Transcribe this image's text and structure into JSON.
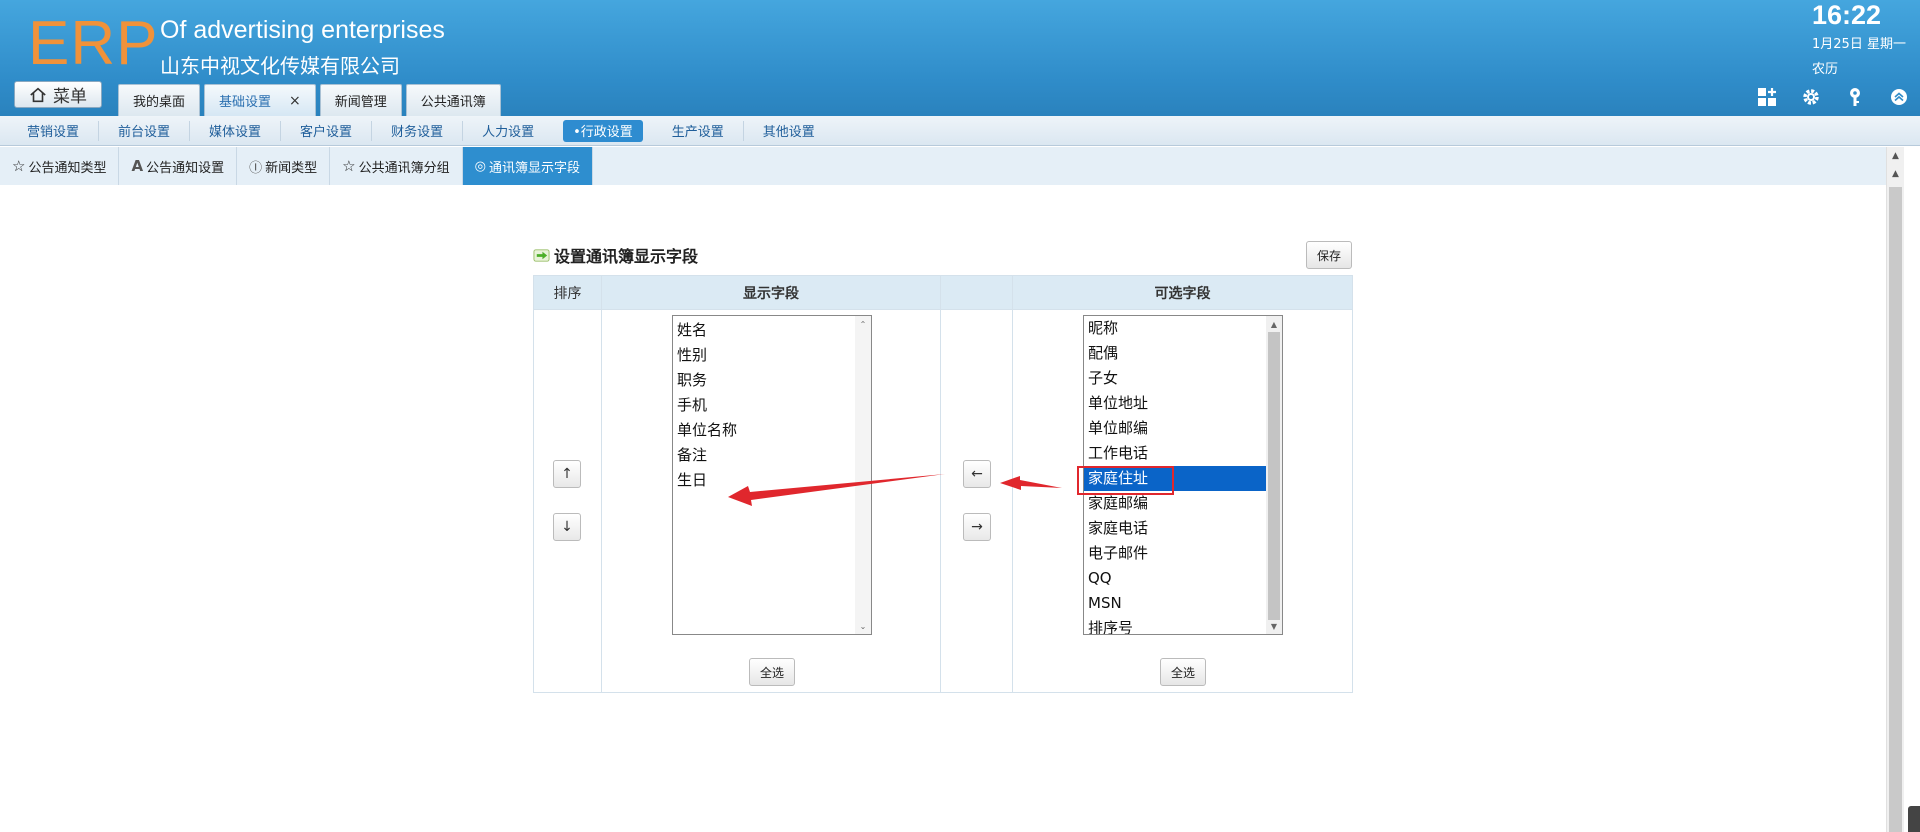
{
  "header": {
    "logo": "ERP",
    "tagline_en": "Of advertising enterprises",
    "company": "山东中视文化传媒有限公司",
    "menu_button": "菜单",
    "tabs": [
      {
        "label": "我的桌面"
      },
      {
        "label": "基础设置",
        "close": "×"
      },
      {
        "label": "新闻管理"
      },
      {
        "label": "公共通讯簿"
      }
    ],
    "clock": "16:22",
    "date": "1月25日 星期一",
    "lunar": "农历",
    "icons": [
      "dashboard-icon",
      "gear-icon",
      "key-icon",
      "collapse-up-icon"
    ]
  },
  "menubar": {
    "items": [
      "营销设置",
      "前台设置",
      "媒体设置",
      "客户设置",
      "财务设置",
      "人力设置",
      "•行政设置",
      "生产设置",
      "其他设置"
    ],
    "active_index": 6
  },
  "subtabs": [
    {
      "icon": "star-icon",
      "glyph": "☆",
      "label": "公告通知类型"
    },
    {
      "icon": "font-icon",
      "glyph": "A",
      "label": "公告通知设置"
    },
    {
      "icon": "pause-circle-icon",
      "glyph": "Ⓘ",
      "label": "新闻类型"
    },
    {
      "icon": "star-icon",
      "glyph": "☆",
      "label": "公共通讯簿分组"
    },
    {
      "icon": "globe-icon",
      "glyph": "◎",
      "label": "通讯簿显示字段"
    }
  ],
  "panel": {
    "title": "设置通讯簿显示字段",
    "save": "保存",
    "col_sort": "排序",
    "col_display": "显示字段",
    "col_available": "可选字段",
    "up": "↑",
    "down": "↓",
    "move_left": "←",
    "move_right": "→",
    "select_all": "全选"
  },
  "display_fields": [
    "姓名",
    "性别",
    "职务",
    "手机",
    "单位名称",
    "备注",
    "生日"
  ],
  "available_fields": [
    "昵称",
    "配偶",
    "子女",
    "单位地址",
    "单位邮编",
    "工作电话",
    "家庭住址",
    "家庭邮编",
    "家庭电话",
    "电子邮件",
    "QQ",
    "MSN",
    "排序号"
  ],
  "selected_available": "家庭住址",
  "colors": {
    "accent": "#2e8ecf",
    "header": "#3597d3",
    "logo": "#f0923a",
    "annotation": "#e0272d"
  }
}
